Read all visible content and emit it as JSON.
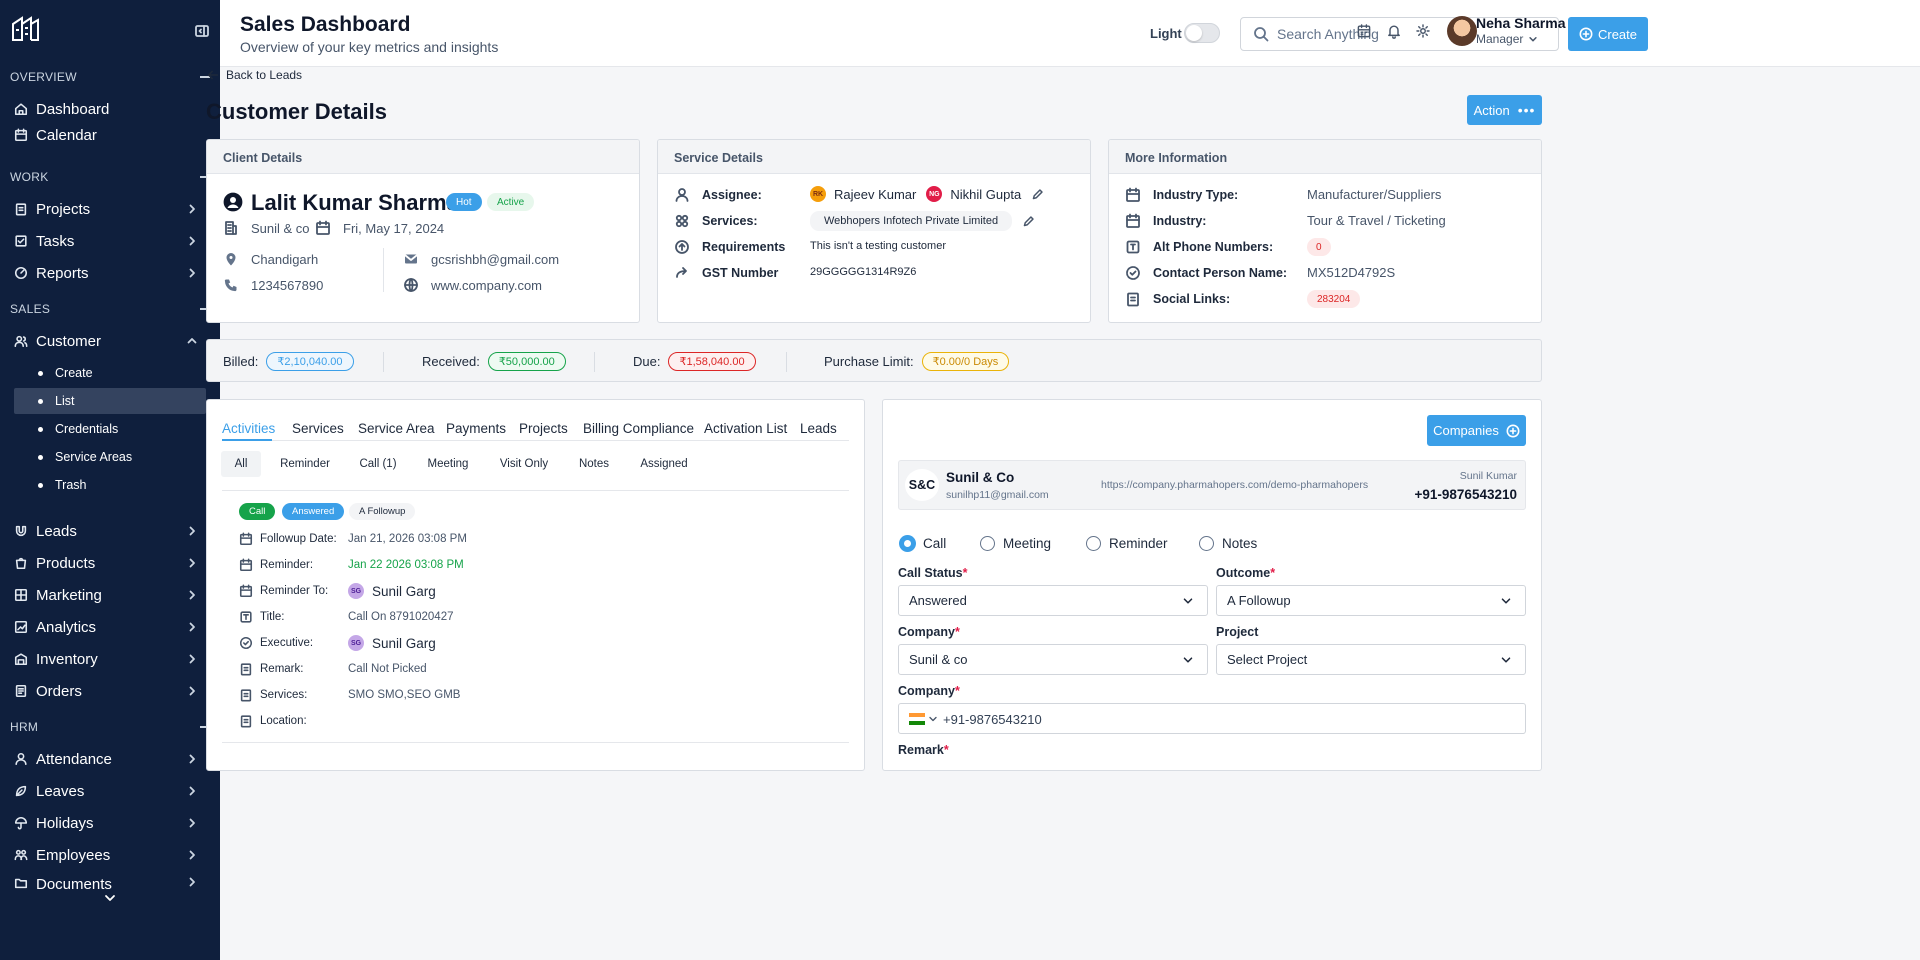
{
  "sidebar": {
    "sections": [
      {
        "label": "OVERVIEW"
      },
      {
        "label": "WORK"
      },
      {
        "label": "SALES"
      },
      {
        "label": "HRM"
      }
    ],
    "items": {
      "dashboard": "Dashboard",
      "calendar": "Calendar",
      "projects": "Projects",
      "tasks": "Tasks",
      "reports": "Reports",
      "customer": "Customer",
      "leads": "Leads",
      "products": "Products",
      "marketing": "Marketing",
      "analytics": "Analytics",
      "inventory": "Inventory",
      "orders": "Orders",
      "attendance": "Attendance",
      "leaves": "Leaves",
      "holidays": "Holidays",
      "employees": "Employees",
      "documents": "Documents"
    },
    "customer_sub": [
      "Create",
      "List",
      "Credentials",
      "Service Areas",
      "Trash"
    ],
    "active_sub": "List"
  },
  "header": {
    "title": "Sales Dashboard",
    "subtitle": "Overview of your key metrics and insights",
    "theme_label": "Light",
    "search_placeholder": "Search Anything",
    "create_label": "Create",
    "user_name": "Neha Sharma",
    "user_role": "Manager"
  },
  "page": {
    "back_label": "Back to Leads",
    "title": "Customer Details",
    "action_label": "Action"
  },
  "client": {
    "heading": "Client Details",
    "name": "Lalit Kumar Sharma",
    "badges": [
      "Hot",
      "Active"
    ],
    "company": "Sunil & co",
    "date": "Fri, May 17, 2024",
    "city": "Chandigarh",
    "phone": "1234567890",
    "email": "gcsrishbh@gmail.com",
    "website": "www.company.com"
  },
  "service": {
    "heading": "Service Details",
    "assignee_label": "Assignee:",
    "assignees": [
      {
        "initials": "RK",
        "name": "Rajeev Kumar"
      },
      {
        "initials": "NG",
        "name": "Nikhil Gupta"
      }
    ],
    "services_label": "Services:",
    "services_value": "Webhopers Infotech Private Limited",
    "requirements_label": "Requirements",
    "requirements_value": "This isn't a testing customer",
    "gst_label": "GST Number",
    "gst_value": "29GGGGG1314R9Z6"
  },
  "more": {
    "heading": "More Information",
    "rows": [
      {
        "label": "Industry Type:",
        "value": "Manufacturer/Suppliers"
      },
      {
        "label": "Industry:",
        "value": "Tour & Travel / Ticketing"
      },
      {
        "label": "Alt Phone Numbers:",
        "value": "0"
      },
      {
        "label": "Contact Person Name:",
        "value": "MX512D4792S"
      },
      {
        "label": "Social Links:",
        "value": "283204"
      }
    ]
  },
  "billing": {
    "billed_label": "Billed:",
    "billed": "₹2,10,040.00",
    "received_label": "Received:",
    "received": "₹50,000.00",
    "due_label": "Due:",
    "due": "₹1,58,040.00",
    "limit_label": "Purchase Limit:",
    "limit": "₹0.00/0 Days"
  },
  "tabs": [
    "Activities",
    "Services",
    "Service Area",
    "Payments",
    "Projects",
    "Billing Compliance",
    "Activation List",
    "Leads"
  ],
  "filters": [
    "All",
    "Reminder",
    "Call (1)",
    "Meeting",
    "Visit Only",
    "Notes",
    "Assigned"
  ],
  "activity": {
    "tags": [
      "Call",
      "Answered",
      "A Followup"
    ],
    "rows": [
      {
        "label": "Followup Date:",
        "value": "Jan 21, 2026 03:08 PM"
      },
      {
        "label": "Reminder:",
        "value": "Jan 22 2026 03:08 PM"
      },
      {
        "label": "Reminder To:",
        "value": "Sunil Garg",
        "initials": "SG"
      },
      {
        "label": "Title:",
        "value": "Call On 8791020427"
      },
      {
        "label": "Executive:",
        "value": "Sunil Garg",
        "initials": "SG"
      },
      {
        "label": "Remark:",
        "value": "Call Not Picked"
      },
      {
        "label": "Services:",
        "value": "SMO SMO,SEO GMB"
      },
      {
        "label": "Location:",
        "value": ""
      }
    ]
  },
  "form": {
    "companies_label": "Companies",
    "company_card": {
      "initials": "S&C",
      "name": "Sunil & Co",
      "email": "sunilhp11@gmail.com",
      "url": "https://company.pharmahopers.com/demo-pharmahopers",
      "contact": "Sunil Kumar",
      "phone": "+91-9876543210"
    },
    "radios": [
      "Call",
      "Meeting",
      "Reminder",
      "Notes"
    ],
    "call_status_label": "Call Status",
    "call_status": "Answered",
    "outcome_label": "Outcome",
    "outcome": "A Followup",
    "company_label": "Company",
    "company": "Sunil & co",
    "project_label": "Project",
    "project": "Select Project",
    "phone_label": "Company",
    "phone": "+91-9876543210",
    "remark_label": "Remark"
  },
  "colors": {
    "sidebar": "#0f1f3d",
    "accent": "#3b9fe8",
    "green": "#16a34a",
    "red": "#dc2626",
    "amber": "#eab308"
  }
}
